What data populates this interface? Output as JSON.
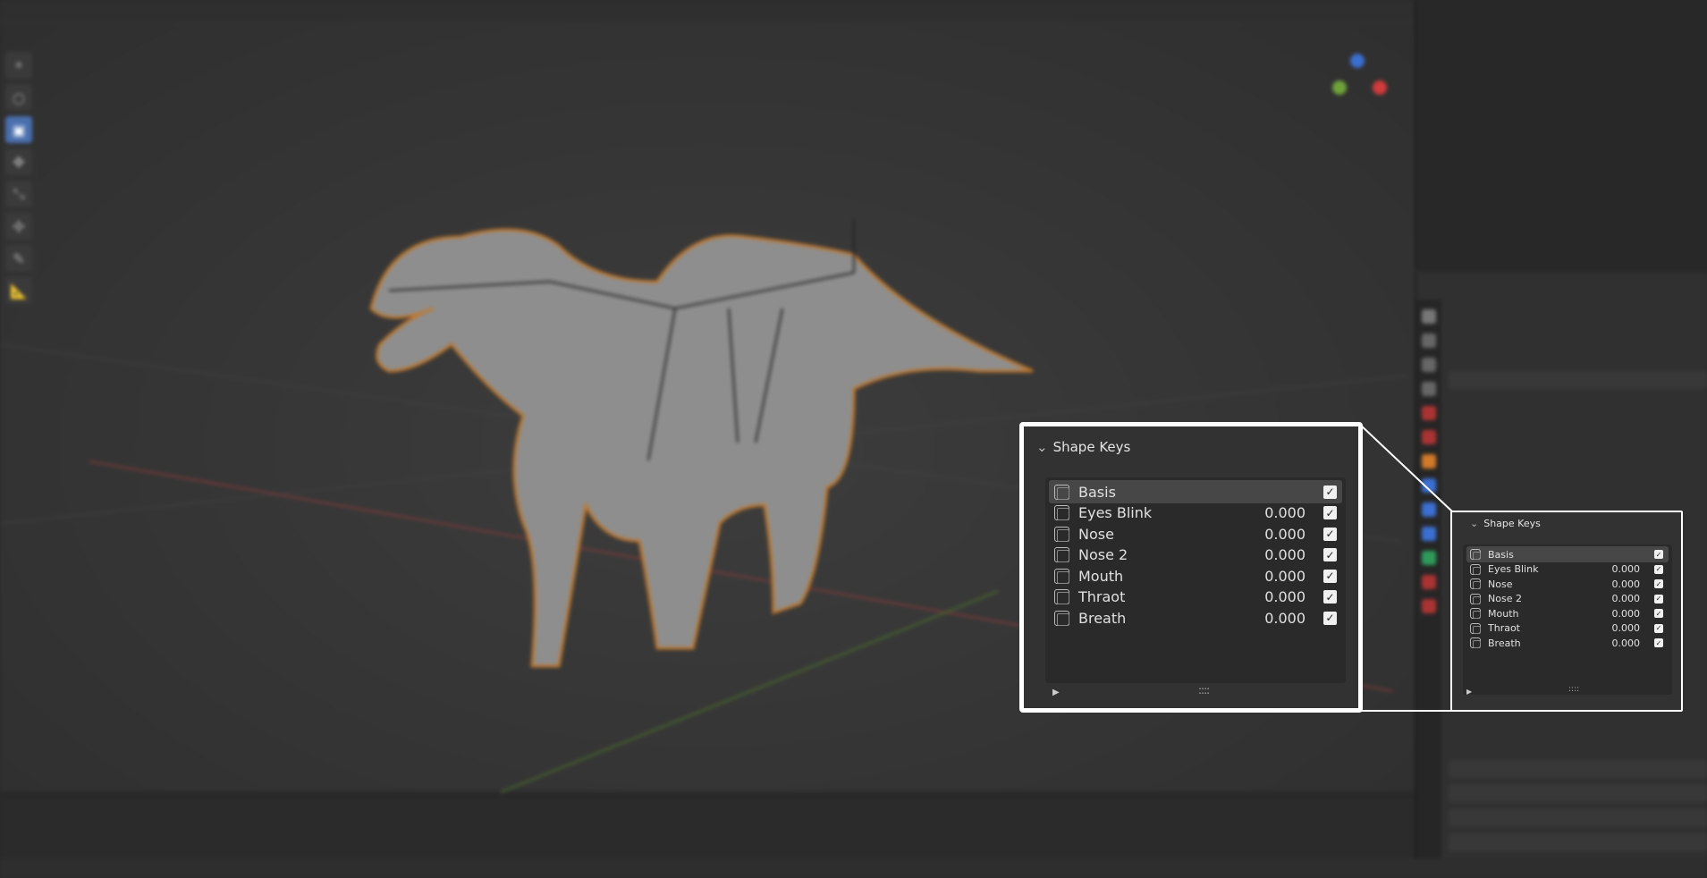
{
  "shape_keys_panel": {
    "title": "Shape Keys",
    "items": [
      {
        "name": "Basis",
        "value": "",
        "enabled": true,
        "selected": true
      },
      {
        "name": "Eyes Blink",
        "value": "0.000",
        "enabled": true,
        "selected": false
      },
      {
        "name": "Nose",
        "value": "0.000",
        "enabled": true,
        "selected": false
      },
      {
        "name": "Nose 2",
        "value": "0.000",
        "enabled": true,
        "selected": false
      },
      {
        "name": "Mouth",
        "value": "0.000",
        "enabled": true,
        "selected": false
      },
      {
        "name": "Thraot",
        "value": "0.000",
        "enabled": true,
        "selected": false
      },
      {
        "name": "Breath",
        "value": "0.000",
        "enabled": true,
        "selected": false
      }
    ],
    "play_glyph": "▶",
    "grip_glyph": "::::"
  },
  "colors": {
    "highlight_border": "#ffffff",
    "panel_bg": "#323232",
    "list_bg": "#2a2a2a",
    "selected_row": "#474747",
    "active_tool": "#4a6fae",
    "mesh_outline": "#c0782c"
  },
  "icons": {
    "shape_key": "shape-key-icon",
    "checkbox": "checkbox-icon",
    "collapse": "chevron-down-icon",
    "play": "play-icon"
  }
}
